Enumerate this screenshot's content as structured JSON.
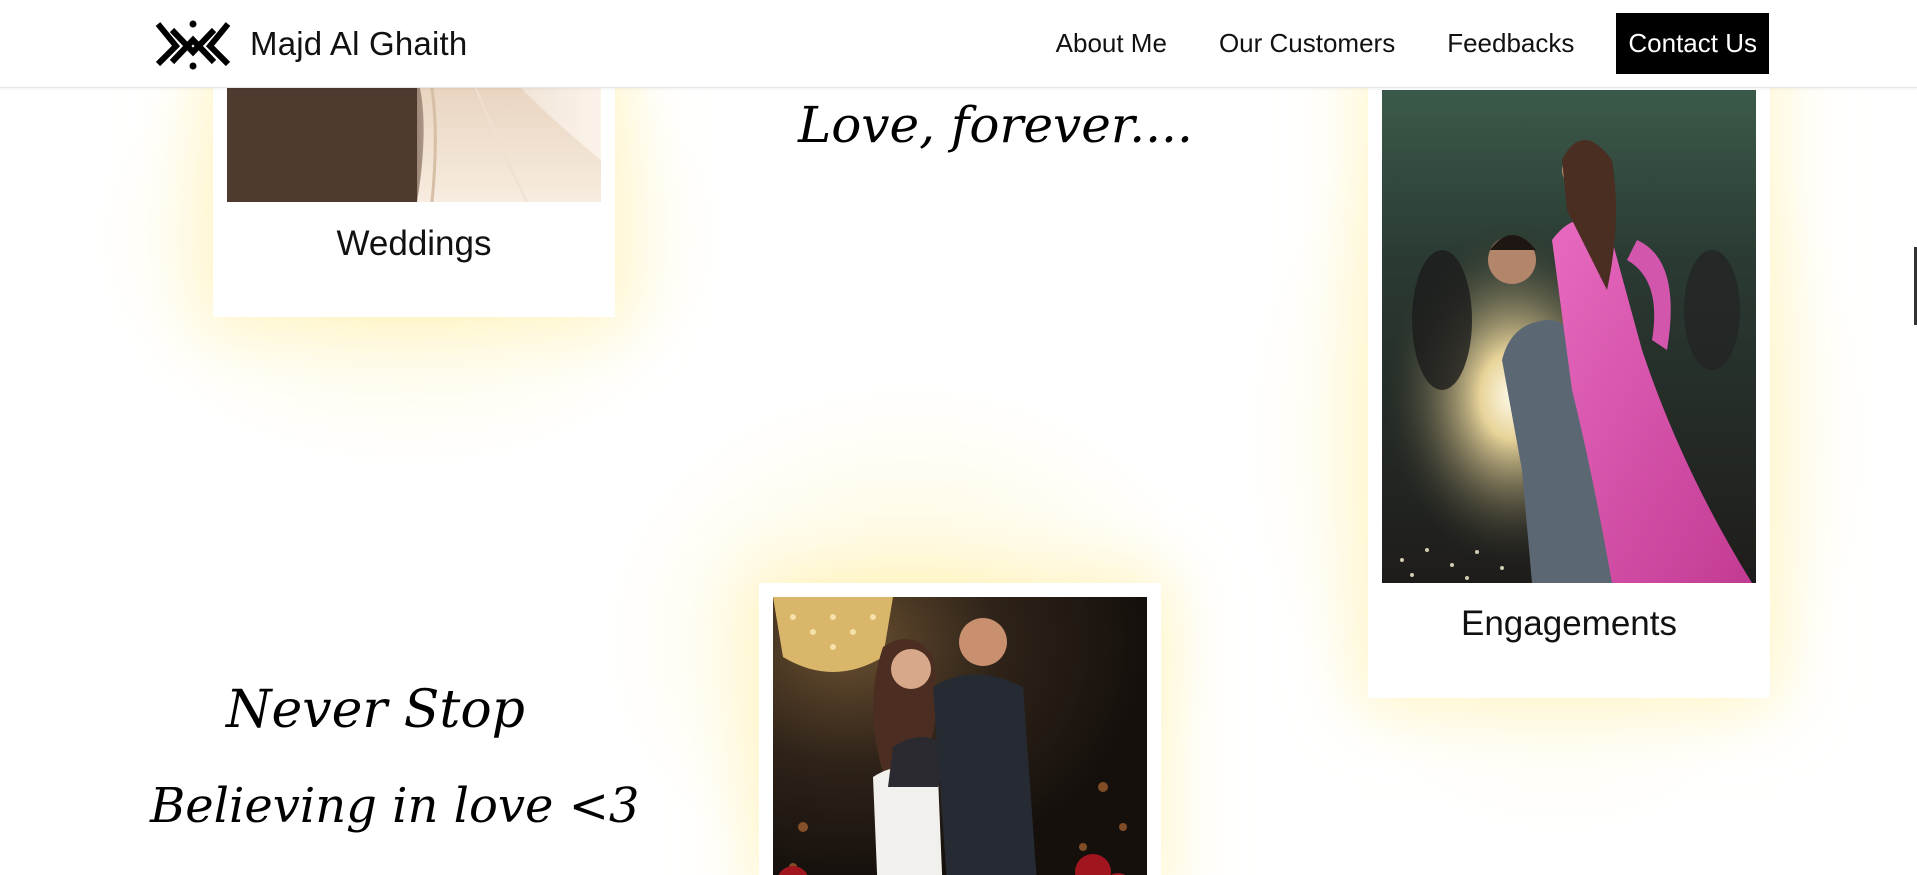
{
  "header": {
    "brand_name": "Majd Al Ghaith",
    "nav": [
      {
        "label": "About Me"
      },
      {
        "label": "Our Customers"
      },
      {
        "label": "Feedbacks"
      },
      {
        "label": "Contact Us"
      }
    ]
  },
  "cards": {
    "weddings": {
      "label": "Weddings"
    },
    "engagements": {
      "label": "Engagements"
    }
  },
  "quotes": {
    "love_forever": "Love, forever....",
    "never_stop": "Never Stop",
    "believing": "Believing in love <3"
  },
  "colors": {
    "accent": "#000000",
    "glow": "#fff0aa",
    "dress_pink": "#d9459f"
  }
}
